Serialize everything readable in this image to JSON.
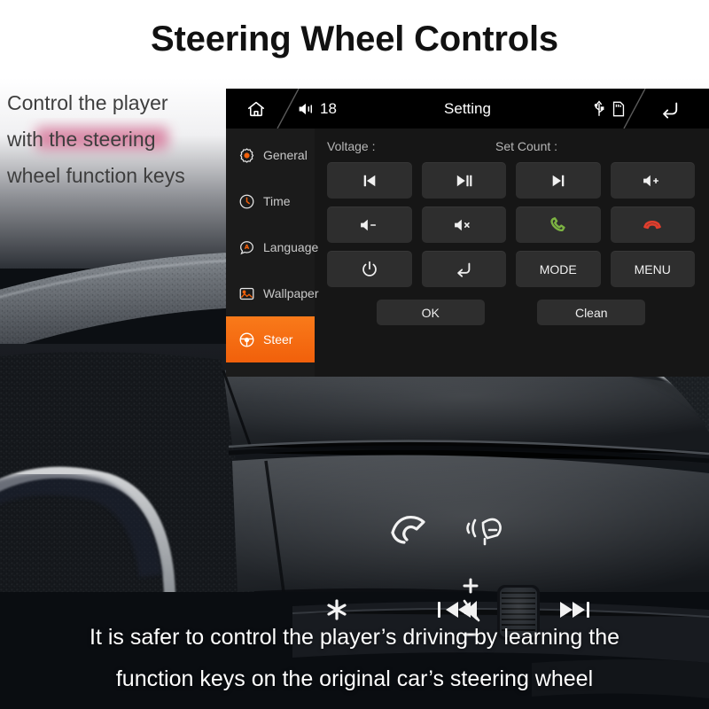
{
  "page": {
    "title": "Steering Wheel Controls",
    "left_description": [
      "Control the player",
      "with the steering",
      "wheel function keys"
    ],
    "bottom_caption": [
      "It is safer to control the player’s driving by learning the",
      "function keys on the original car’s steering wheel"
    ]
  },
  "colors": {
    "accent_orange": "#f1600b",
    "panel_bg": "#161616",
    "statusbar_bg": "#000000",
    "sidebar_bg": "#1b1b1b",
    "key_bg": "#2e2e2e",
    "call_green": "#7cb342",
    "hangup_red": "#e03e2d",
    "title_color": "#111111",
    "caption_color": "#ffffff"
  },
  "unit": {
    "statusbar": {
      "home_icon": "home-icon",
      "volume_icon": "speaker-icon",
      "volume_value": "18",
      "title": "Setting",
      "usb_icon": "usb-icon",
      "sd_icon": "sd-card-icon",
      "back_icon": "back-arrow-icon"
    },
    "sidebar": {
      "items": [
        {
          "label": "General",
          "icon": "gear-icon",
          "active": false
        },
        {
          "label": "Time",
          "icon": "clock-icon",
          "active": false
        },
        {
          "label": "Language",
          "icon": "language-icon",
          "active": false
        },
        {
          "label": "Wallpaper",
          "icon": "image-icon",
          "active": false
        },
        {
          "label": "Steer",
          "icon": "steering-icon",
          "active": true
        }
      ]
    },
    "content": {
      "labels": {
        "voltage": "Voltage :",
        "set_count": "Set Count :"
      },
      "keys": [
        {
          "label": "",
          "icon": "previous-track-icon"
        },
        {
          "label": "",
          "icon": "play-pause-icon"
        },
        {
          "label": "",
          "icon": "next-track-icon"
        },
        {
          "label": "",
          "icon": "volume-up-icon"
        },
        {
          "label": "",
          "icon": "volume-down-icon"
        },
        {
          "label": "",
          "icon": "volume-mute-icon"
        },
        {
          "label": "",
          "icon": "phone-answer-icon"
        },
        {
          "label": "",
          "icon": "phone-hangup-icon"
        },
        {
          "label": "",
          "icon": "power-icon"
        },
        {
          "label": "",
          "icon": "enter-return-icon"
        },
        {
          "label": "MODE",
          "icon": ""
        },
        {
          "label": "MENU",
          "icon": ""
        }
      ],
      "actions": [
        {
          "label": "OK"
        },
        {
          "label": "Clean"
        }
      ]
    }
  },
  "photo": {
    "steering_wheel_icons": [
      "phone-icon",
      "voice-command-icon",
      "asterisk-icon",
      "previous-track-icon",
      "mute-icon",
      "plus-icon",
      "minus-icon",
      "scroll-wheel",
      "next-track-icon"
    ]
  }
}
